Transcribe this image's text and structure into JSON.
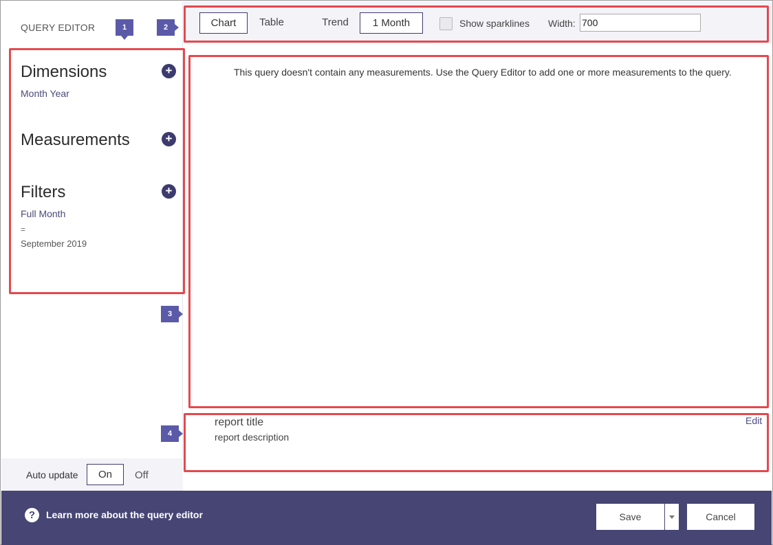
{
  "header": {
    "title": "QUERY EDITOR"
  },
  "sections": {
    "dimensions": {
      "title": "Dimensions",
      "items": [
        "Month Year"
      ]
    },
    "measurements": {
      "title": "Measurements"
    },
    "filters": {
      "title": "Filters",
      "field": "Full Month",
      "operator": "=",
      "value": "September 2019"
    }
  },
  "auto_update": {
    "label": "Auto update",
    "on": "On",
    "off": "Off",
    "selected": "On"
  },
  "toolbar": {
    "chart": "Chart",
    "table": "Table",
    "trend": "Trend",
    "period": "1 Month",
    "sparklines_label": "Show sparklines",
    "sparklines_checked": false,
    "width_label": "Width:",
    "width_value": "700"
  },
  "main": {
    "empty_message": "This query doesn't contain any measurements. Use the Query Editor to add one or more measurements to the query."
  },
  "report": {
    "title": "report title",
    "description": "report description",
    "edit": "Edit"
  },
  "callouts": [
    "1",
    "2",
    "3",
    "4"
  ],
  "footer": {
    "help_text": "Learn more about the query editor",
    "save": "Save",
    "cancel": "Cancel"
  },
  "colors": {
    "accent": "#3c3b6e",
    "footer": "#464574",
    "highlight": "#e5484d",
    "callout": "#5b5aa8"
  }
}
